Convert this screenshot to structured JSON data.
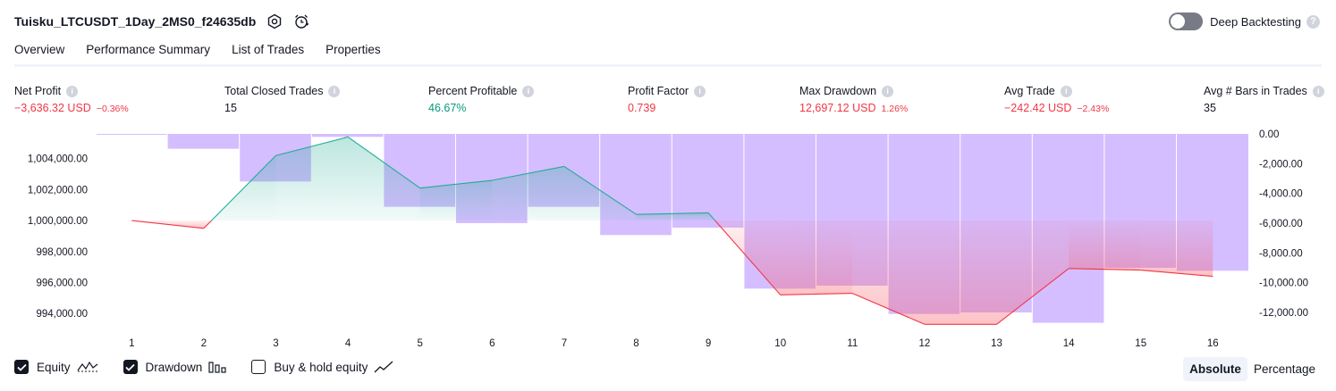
{
  "header": {
    "title": "Tuisku_LTCUSDT_1Day_2MS0_f24635db",
    "deep_backtesting_label": "Deep Backtesting",
    "deep_backtesting_enabled": false,
    "help_glyph": "?"
  },
  "tabs": [
    {
      "label": "Overview",
      "active": true
    },
    {
      "label": "Performance Summary",
      "active": false
    },
    {
      "label": "List of Trades",
      "active": false
    },
    {
      "label": "Properties",
      "active": false
    }
  ],
  "metrics": {
    "info_glyph": "i",
    "net_profit": {
      "label": "Net Profit",
      "value": "−3,636.32 USD",
      "sub": "−0.36%"
    },
    "total_closed_trades": {
      "label": "Total Closed Trades",
      "value": "15"
    },
    "percent_profitable": {
      "label": "Percent Profitable",
      "value": "46.67%"
    },
    "profit_factor": {
      "label": "Profit Factor",
      "value": "0.739"
    },
    "max_drawdown": {
      "label": "Max Drawdown",
      "value": "12,697.12 USD",
      "sub": "1.26%"
    },
    "avg_trade": {
      "label": "Avg Trade",
      "value": "−242.42 USD",
      "sub": "−2.43%"
    },
    "avg_bars": {
      "label": "Avg # Bars in Trades",
      "value": "35"
    }
  },
  "chart_data": {
    "type": "line",
    "x": [
      1,
      2,
      3,
      4,
      5,
      6,
      7,
      8,
      9,
      10,
      11,
      12,
      13,
      14,
      15,
      16
    ],
    "equity_baseline": 1000000,
    "series": [
      {
        "name": "Equity",
        "values": [
          1000000,
          999500,
          1004200,
          1005400,
          1002100,
          1002600,
          1003500,
          1000400,
          1000500,
          995200,
          995300,
          993300,
          993300,
          996900,
          996800,
          996400
        ]
      },
      {
        "name": "Drawdown",
        "values": [
          0,
          -1000,
          -3200,
          -200,
          -4900,
          -6000,
          -4900,
          -6800,
          -6300,
          -10400,
          -10200,
          -12100,
          -12000,
          -12697,
          -9000,
          -9200
        ]
      }
    ],
    "left_axis": {
      "ticks": [
        "1,004,000.00",
        "1,002,000.00",
        "1,000,000.00",
        "998,000.00",
        "996,000.00",
        "994,000.00"
      ],
      "range": [
        993200,
        1005600
      ]
    },
    "right_axis": {
      "ticks": [
        "0.00",
        "-2,000.00",
        "-4,000.00",
        "-6,000.00",
        "-8,000.00",
        "-10,000.00",
        "-12,000.00"
      ],
      "range": [
        -12900,
        0
      ]
    },
    "colors": {
      "profit_line": "#22ab94",
      "loss_line": "#f23645",
      "drawdown_bar": "#ceb3ff",
      "profit_fill": "#22ab94",
      "loss_fill": "#f7525f"
    }
  },
  "legend": [
    {
      "label": "Equity",
      "checked": true,
      "icon": "equity-line-icon"
    },
    {
      "label": "Drawdown",
      "checked": true,
      "icon": "drawdown-bars-icon"
    },
    {
      "label": "Buy & hold equity",
      "checked": false,
      "icon": "buy-hold-line-icon"
    }
  ],
  "mode": {
    "absolute_label": "Absolute",
    "percentage_label": "Percentage",
    "selected": "Absolute"
  }
}
